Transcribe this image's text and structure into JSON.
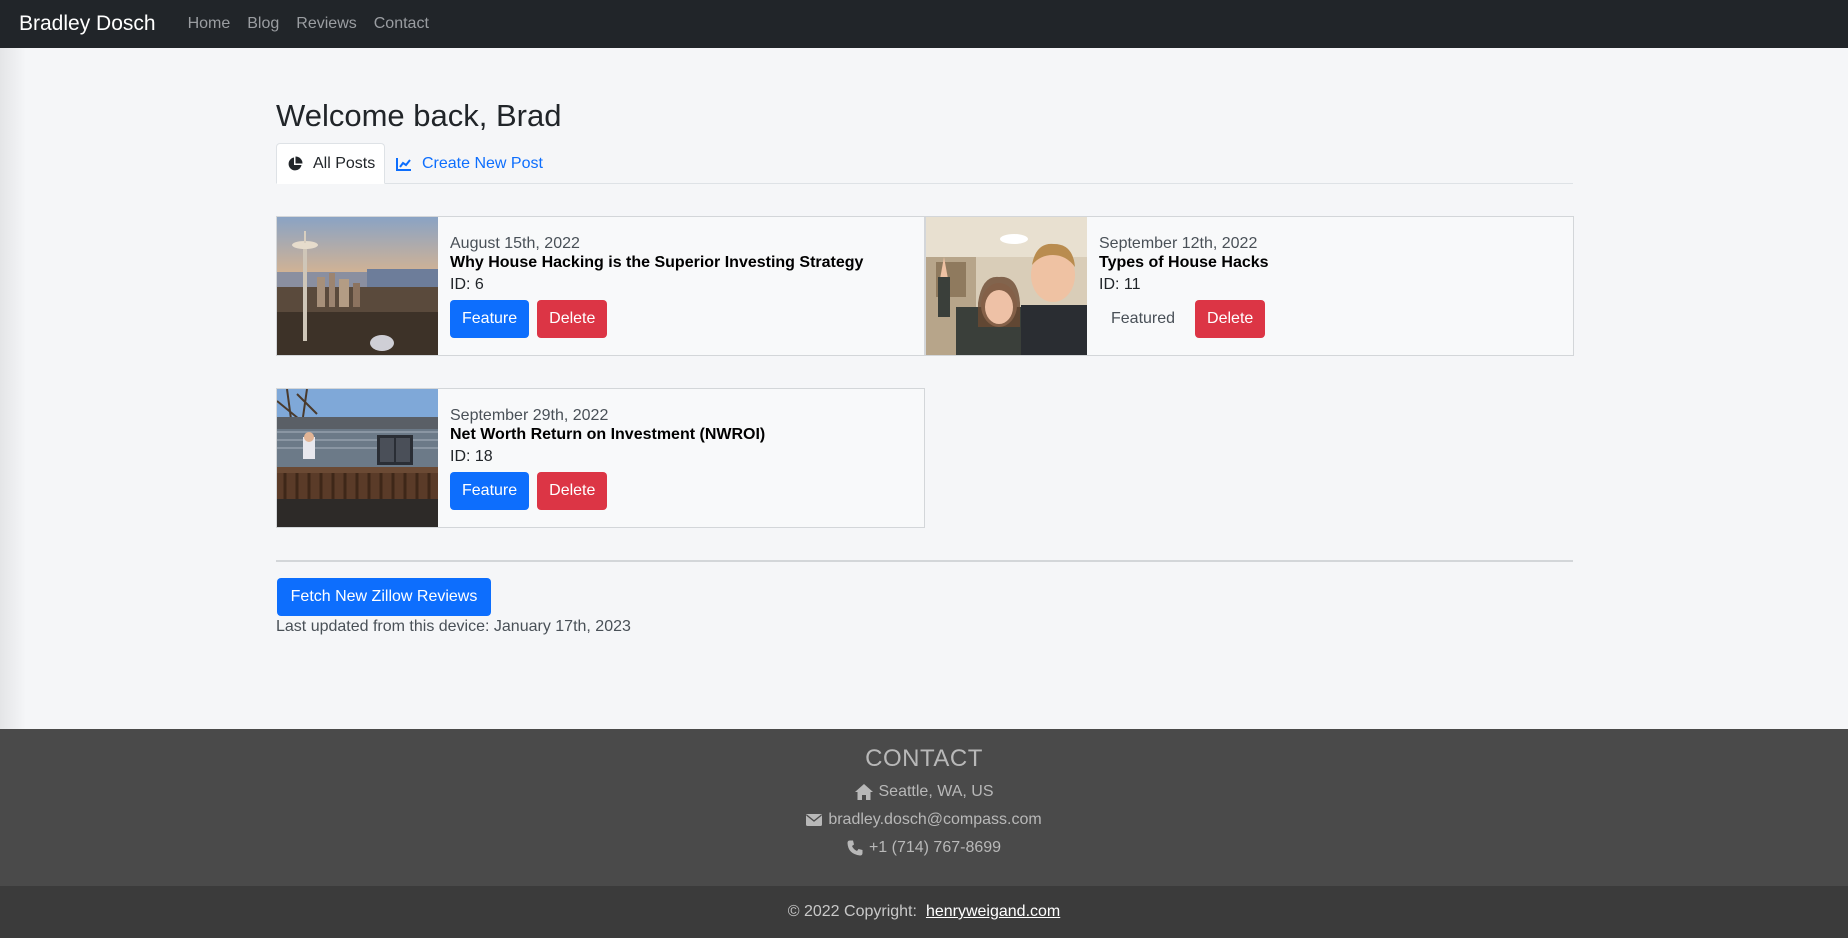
{
  "navbar": {
    "brand": "Bradley Dosch",
    "links": [
      "Home",
      "Blog",
      "Reviews",
      "Contact"
    ]
  },
  "welcome": "Welcome back, Brad",
  "tabs": {
    "all_posts": "All Posts",
    "create_new_post": "Create New Post"
  },
  "posts": [
    {
      "date": "August 15th, 2022",
      "title": "Why House Hacking is the Superior Investing Strategy",
      "id_text": "ID: 6",
      "feature_label": "Feature",
      "delete_label": "Delete"
    },
    {
      "date": "September 12th, 2022",
      "title": "Types of House Hacks",
      "id_text": "ID: 11",
      "featured_label": "Featured",
      "delete_label": "Delete"
    },
    {
      "date": "September 29th, 2022",
      "title": "Net Worth Return on Investment (NWROI)",
      "id_text": "ID: 18",
      "feature_label": "Feature",
      "delete_label": "Delete"
    }
  ],
  "fetch_button": "Fetch New Zillow Reviews",
  "last_updated": "Last updated from this device: January 17th, 2023",
  "footer": {
    "heading": "CONTACT",
    "location": "Seattle, WA, US",
    "email": "bradley.dosch@compass.com",
    "phone": "+1 (714) 767-8699",
    "copyright": "© 2022 Copyright:",
    "site_link": "henryweigand.com"
  },
  "colors": {
    "primary": "#0d6efd",
    "danger": "#dc3545",
    "navbar": "#212529",
    "footer": "#4a4a4a"
  },
  "icons": [
    "pie-chart-icon",
    "line-chart-icon",
    "home-icon",
    "envelope-icon",
    "phone-icon"
  ]
}
